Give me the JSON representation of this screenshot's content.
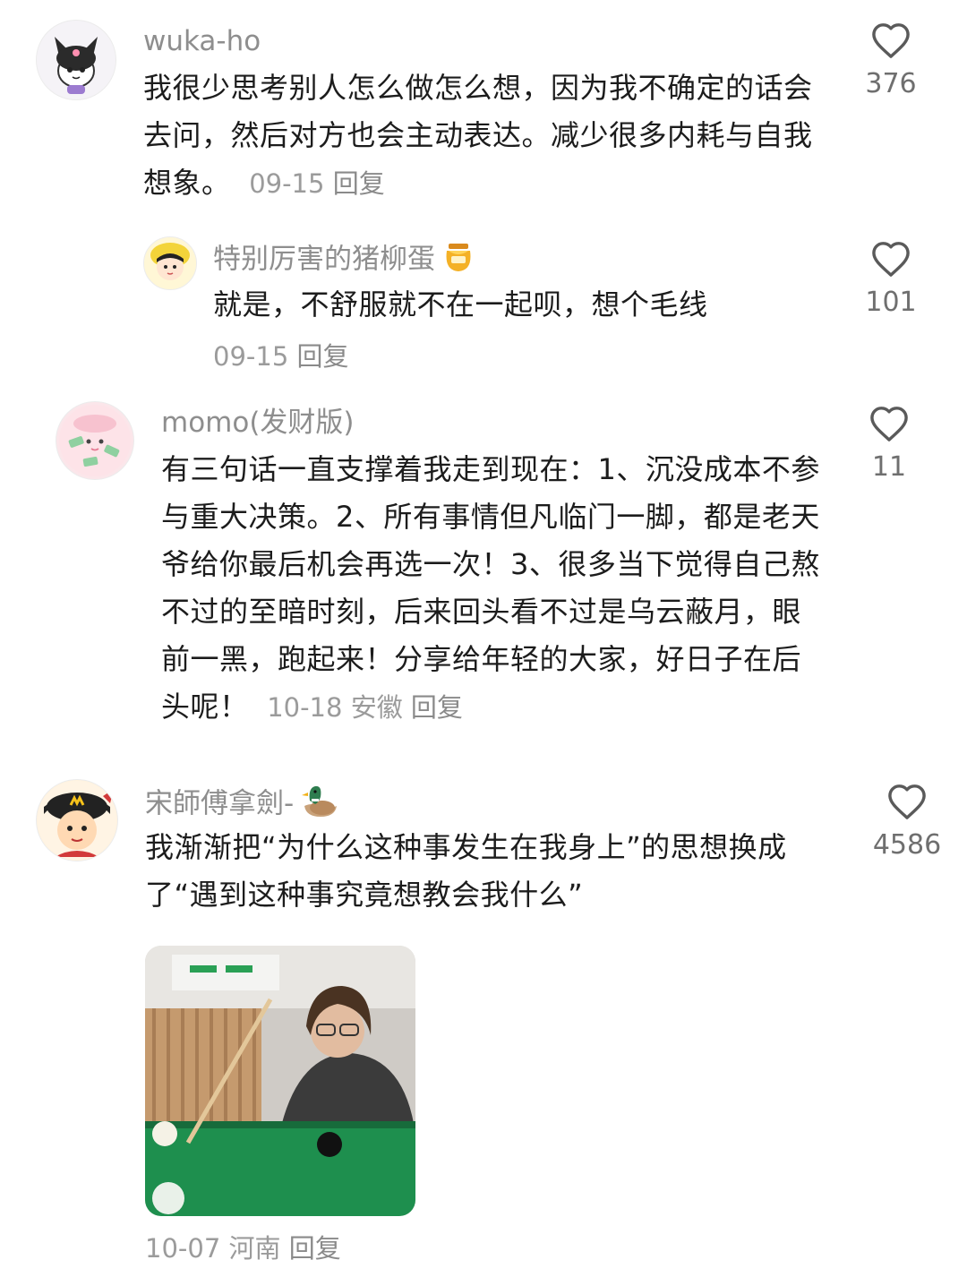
{
  "comments": [
    {
      "username": "wuka-ho",
      "text": "我很少思考别人怎么做怎么想，因为我不确定的话会去问，然后对方也会主动表达。减少很多内耗与自我想象。",
      "date": "09-15",
      "reply_label": "回复",
      "likes": "376"
    },
    {
      "username": "特别厉害的猪柳蛋",
      "text": "就是，不舒服就不在一起呗，想个毛线",
      "date": "09-15",
      "reply_label": "回复",
      "likes": "101"
    },
    {
      "username": "momo(发财版)",
      "text": "有三句话一直支撑着我走到现在：1、沉没成本不参与重大决策。2、所有事情但凡临门一脚，都是老天爷给你最后机会再选一次！3、很多当下觉得自己熬不过的至暗时刻，后来回头看不过是乌云蔽月，眼前一黑，跑起来！分享给年轻的大家，好日子在后头呢！",
      "date": "10-18",
      "location": "安徽",
      "reply_label": "回复",
      "likes": "11"
    },
    {
      "username": "宋師傅拿劍-",
      "text": "我渐渐把“为什么这种事发生在我身上”的思想换成了“遇到这种事究竟想教会我什么”",
      "date": "10-07",
      "location": "河南",
      "reply_label": "回复",
      "likes": "4586"
    }
  ],
  "icons": {
    "like": "heart-outline-icon",
    "honey": "honey-pot-emoji",
    "duck": "duck-emoji"
  },
  "colors": {
    "text": "#1c1c1c",
    "muted": "#8e8e8e",
    "felt": "#1e8f4e"
  }
}
